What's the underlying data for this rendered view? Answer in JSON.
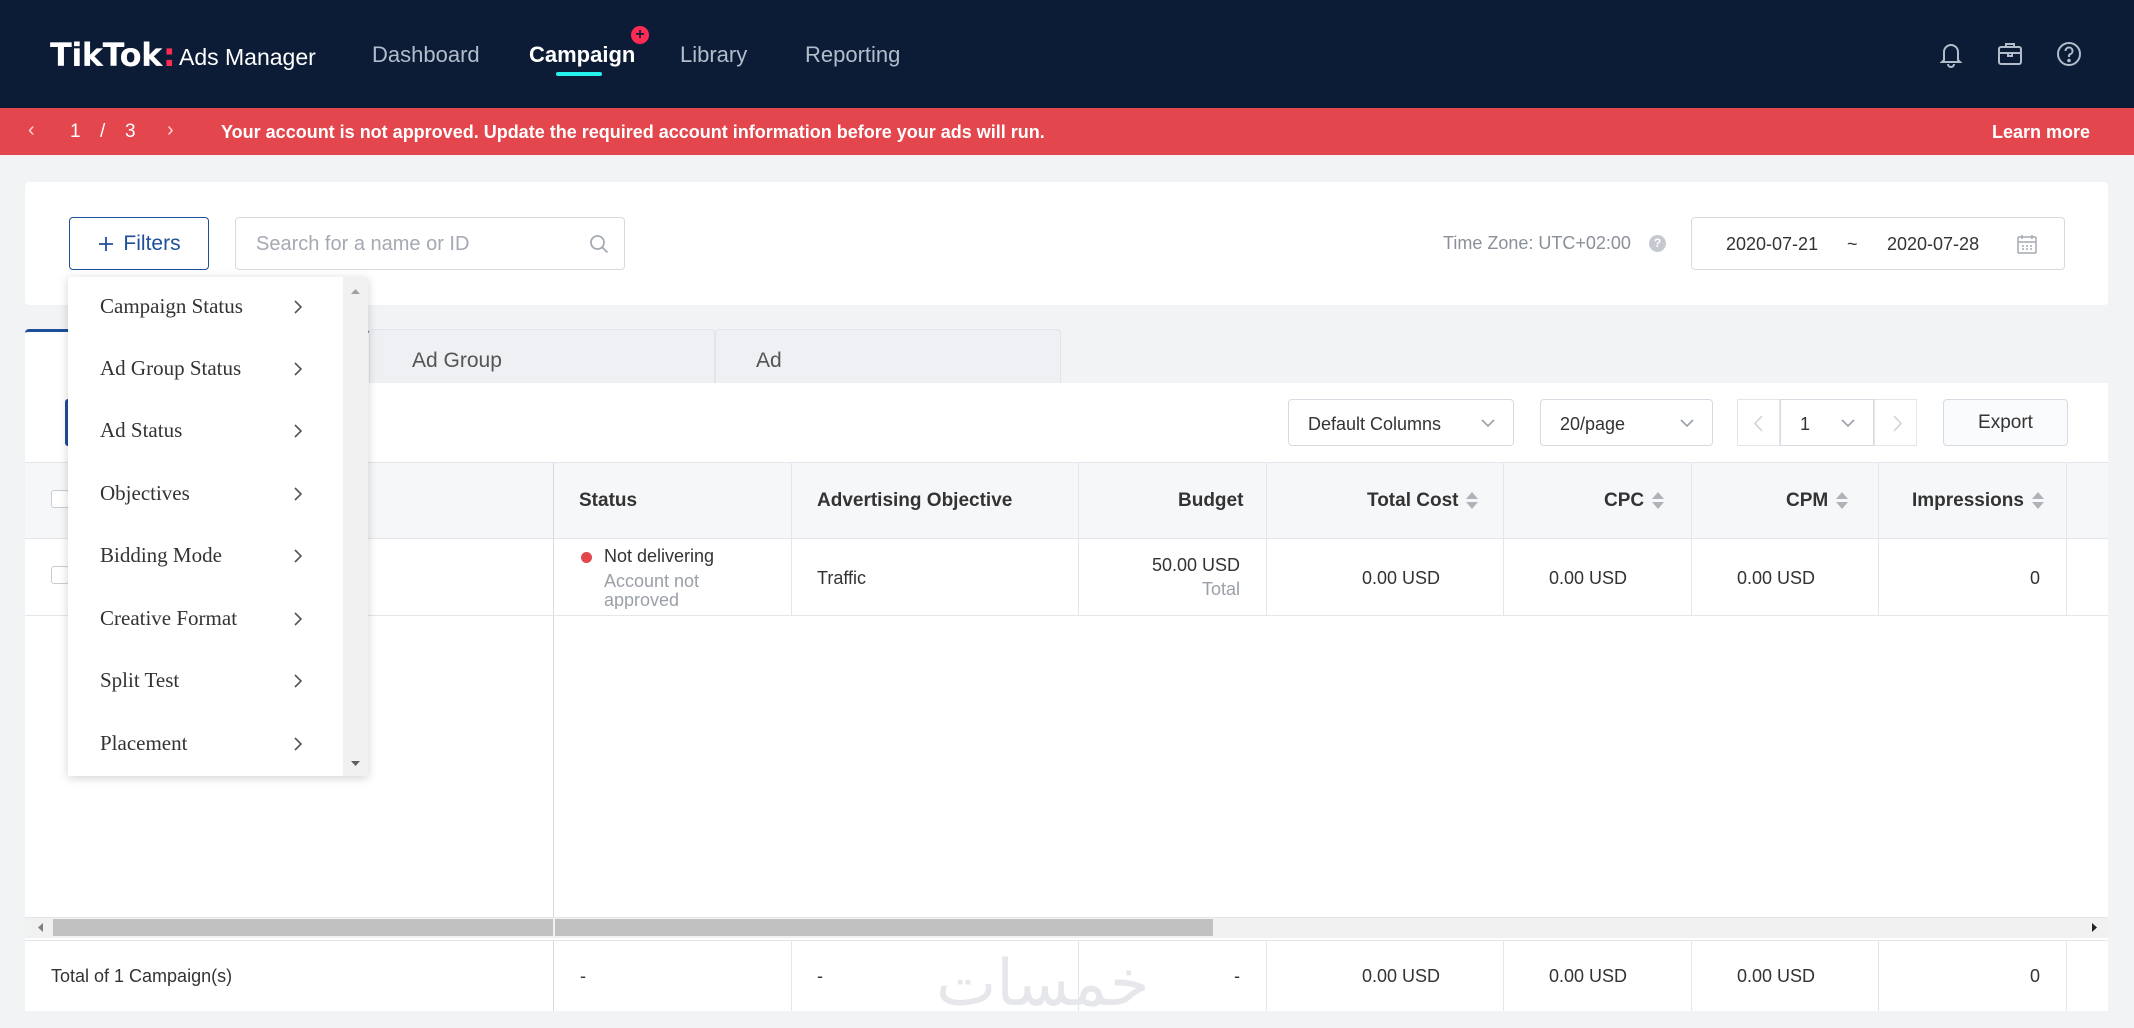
{
  "app": {
    "logo": "TikTok",
    "logo_dot": ":",
    "subtitle": "Ads Manager"
  },
  "nav": {
    "items": [
      {
        "label": "Dashboard",
        "active": false
      },
      {
        "label": "Campaign",
        "active": true
      },
      {
        "label": "Library",
        "active": false
      },
      {
        "label": "Reporting",
        "active": false
      }
    ],
    "campaign_badge": "+",
    "icons": [
      "bell-icon",
      "briefcase-icon",
      "help-icon"
    ]
  },
  "alert": {
    "page_current": "1",
    "page_sep": "/",
    "page_total": "3",
    "message": "Your account is not approved. Update the required account information before your ads will run.",
    "learn_more": "Learn more",
    "color": "#e3464c"
  },
  "filters": {
    "button_label": "Filters",
    "search_placeholder": "Search for a name or ID",
    "timezone": "Time Zone: UTC+02:00",
    "date_start": "2020-07-21",
    "date_sep": "~",
    "date_end": "2020-07-28"
  },
  "filter_menu": {
    "items": [
      "Campaign Status",
      "Ad Group Status",
      "Ad Status",
      "Objectives",
      "Bidding Mode",
      "Creative Format",
      "Split Test",
      "Placement"
    ]
  },
  "tabs": [
    "Ad Group",
    "Ad"
  ],
  "toolbar": {
    "columns_select": "Default Columns",
    "page_size_select": "20/page",
    "page_number": "1",
    "export": "Export"
  },
  "table": {
    "columns": [
      "Status",
      "Advertising Objective",
      "Budget",
      "Total Cost",
      "CPC",
      "CPM",
      "Impressions"
    ],
    "row": {
      "status": "Not delivering",
      "status_detail_1": "Account not",
      "status_detail_2": "approved",
      "objective": "Traffic",
      "budget": "50.00 USD",
      "budget_type": "Total",
      "total_cost": "0.00 USD",
      "cpc": "0.00 USD",
      "cpm": "0.00 USD",
      "impressions": "0"
    },
    "footer": {
      "label": "Total of 1 Campaign(s)",
      "status": "-",
      "objective": "-",
      "budget": "-",
      "total_cost": "0.00 USD",
      "cpc": "0.00 USD",
      "cpm": "0.00 USD",
      "impressions": "0"
    }
  },
  "watermark": "خمسات",
  "colors": {
    "nav_bg": "#0d1c36",
    "brand_blue": "#1f4e9a",
    "accent_cyan": "#25f4ee",
    "accent_pink": "#fe2c55"
  }
}
